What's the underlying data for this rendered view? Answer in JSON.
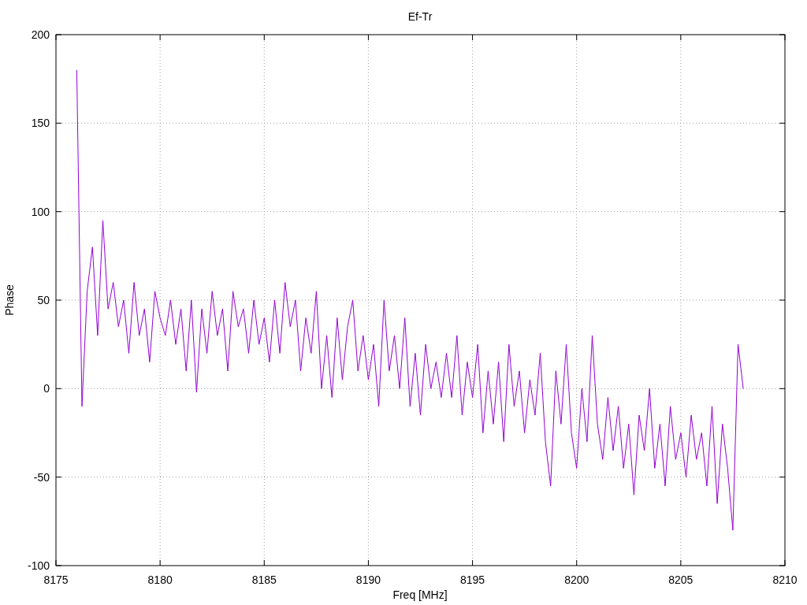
{
  "plot": {
    "chart_data": {
      "type": "line",
      "grid": true,
      "title": "Ef-Tr",
      "xlabel": "Freq [MHz]",
      "ylabel": "Phase",
      "xlim": [
        8175,
        8210
      ],
      "ylim": [
        -100,
        200
      ],
      "xticks": [
        8175,
        8180,
        8185,
        8190,
        8195,
        8200,
        8205,
        8210
      ],
      "yticks": [
        -100,
        -50,
        0,
        50,
        100,
        150,
        200
      ],
      "x": [
        8176,
        8176.25,
        8176.5,
        8176.75,
        8177,
        8177.25,
        8177.5,
        8177.75,
        8178,
        8178.25,
        8178.5,
        8178.75,
        8179,
        8179.25,
        8179.5,
        8179.75,
        8180,
        8180.25,
        8180.5,
        8180.75,
        8181,
        8181.25,
        8181.5,
        8181.75,
        8182,
        8182.25,
        8182.5,
        8182.75,
        8183,
        8183.25,
        8183.5,
        8183.75,
        8184,
        8184.25,
        8184.5,
        8184.75,
        8185,
        8185.25,
        8185.5,
        8185.75,
        8186,
        8186.25,
        8186.5,
        8186.75,
        8187,
        8187.25,
        8187.5,
        8187.75,
        8188,
        8188.25,
        8188.5,
        8188.75,
        8189,
        8189.25,
        8189.5,
        8189.75,
        8190,
        8190.25,
        8190.5,
        8190.75,
        8191,
        8191.25,
        8191.5,
        8191.75,
        8192,
        8192.25,
        8192.5,
        8192.75,
        8193,
        8193.25,
        8193.5,
        8193.75,
        8194,
        8194.25,
        8194.5,
        8194.75,
        8195,
        8195.25,
        8195.5,
        8195.75,
        8196,
        8196.25,
        8196.5,
        8196.75,
        8197,
        8197.25,
        8197.5,
        8197.75,
        8198,
        8198.25,
        8198.5,
        8198.75,
        8199,
        8199.25,
        8199.5,
        8199.75,
        8200,
        8200.25,
        8200.5,
        8200.75,
        8201,
        8201.25,
        8201.5,
        8201.75,
        8202,
        8202.25,
        8202.5,
        8202.75,
        8203,
        8203.25,
        8203.5,
        8203.75,
        8204,
        8204.25,
        8204.5,
        8204.75,
        8205,
        8205.25,
        8205.5,
        8205.75,
        8206,
        8206.25,
        8206.5,
        8206.75,
        8207,
        8207.25,
        8207.5,
        8207.75,
        8208
      ],
      "series": [
        {
          "color": "#9400d3",
          "values": [
            180,
            -10,
            55,
            80,
            30,
            95,
            45,
            60,
            35,
            50,
            20,
            60,
            30,
            45,
            15,
            55,
            40,
            30,
            50,
            25,
            45,
            10,
            50,
            -2,
            45,
            20,
            55,
            30,
            45,
            10,
            55,
            35,
            45,
            20,
            50,
            25,
            40,
            15,
            50,
            20,
            60,
            35,
            50,
            10,
            40,
            20,
            55,
            0,
            30,
            -5,
            40,
            5,
            35,
            50,
            10,
            30,
            5,
            25,
            -10,
            50,
            10,
            30,
            0,
            40,
            -10,
            20,
            -15,
            25,
            0,
            15,
            -5,
            20,
            -5,
            30,
            -15,
            15,
            -5,
            25,
            -25,
            10,
            -20,
            15,
            -30,
            25,
            -10,
            10,
            -25,
            5,
            -15,
            20,
            -30,
            -55,
            10,
            -20,
            25,
            -25,
            -45,
            0,
            -30,
            30,
            -20,
            -40,
            -5,
            -35,
            -10,
            -45,
            -20,
            -60,
            -15,
            -35,
            0,
            -45,
            -20,
            -55,
            -10,
            -40,
            -25,
            -50,
            -15,
            -40,
            -25,
            -55,
            -10,
            -65,
            -20,
            -45,
            -80,
            25,
            0
          ]
        }
      ]
    }
  }
}
